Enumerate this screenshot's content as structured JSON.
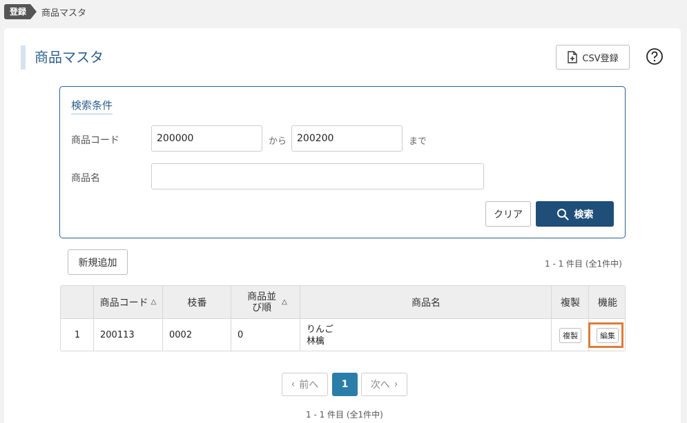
{
  "breadcrumb": {
    "tag": "登録",
    "current": "商品マスタ"
  },
  "header": {
    "title": "商品マスタ",
    "csv_button": "CSV登録"
  },
  "search": {
    "title": "検索条件",
    "code_label": "商品コード",
    "code_from": "200000",
    "from_text": "から",
    "code_to": "200200",
    "to_text": "まで",
    "name_label": "商品名",
    "name_value": "",
    "clear_button": "クリア",
    "search_button": "検索"
  },
  "actions": {
    "new_button": "新規追加",
    "count_top": "1 - 1 件目 (全1件中)"
  },
  "table": {
    "headers": {
      "code": "商品コード",
      "branch": "枝番",
      "sort": "商品並び順",
      "name": "商品名",
      "duplicate": "複製",
      "function": "機能"
    },
    "rows": [
      {
        "no": "1",
        "code": "200113",
        "branch": "0002",
        "sort": "0",
        "name_kana": "りんご",
        "name_kanji": "林檎",
        "duplicate_button": "複製",
        "edit_button": "編集"
      }
    ]
  },
  "pagination": {
    "prev": "前へ",
    "page": "1",
    "next": "次へ",
    "count_bottom": "1 - 1 件目 (全1件中)"
  },
  "colors": {
    "primary": "#1f4e79",
    "title": "#2b5e8e",
    "page_active": "#2b7ea8",
    "highlight": "#e07b39"
  }
}
